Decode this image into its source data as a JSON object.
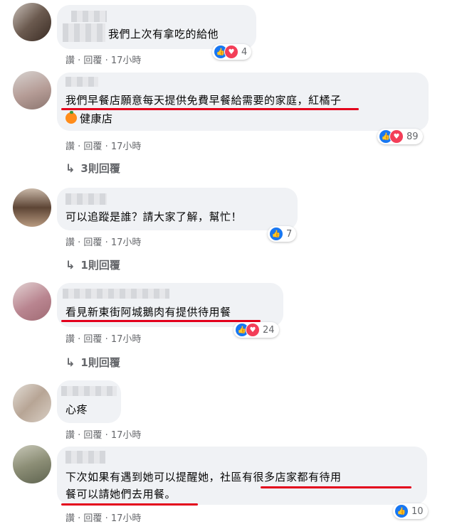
{
  "comments": [
    {
      "text_lines": [
        "我們上次有拿吃的給他"
      ],
      "meta": {
        "like": "讚",
        "reply": "回覆",
        "time": "17小時"
      },
      "reactions": {
        "count": "4",
        "types": [
          "like",
          "love"
        ]
      }
    },
    {
      "text_lines": [
        "我們早餐店願意每天提供免費早餐給需要的家庭，紅橘子",
        "健康店"
      ],
      "meta": {
        "like": "讚",
        "reply": "回覆",
        "time": "17小時"
      },
      "reactions": {
        "count": "89",
        "types": [
          "like",
          "love"
        ]
      },
      "replies_label": "3則回覆"
    },
    {
      "text_lines": [
        "可以追蹤是誰？請大家了解，幫忙！"
      ],
      "meta": {
        "like": "讚",
        "reply": "回覆",
        "time": "17小時"
      },
      "reactions": {
        "count": "7",
        "types": [
          "like"
        ]
      },
      "replies_label": "1則回覆"
    },
    {
      "text_lines": [
        "看見新東街阿城鵝肉有提供待用餐"
      ],
      "meta": {
        "like": "讚",
        "reply": "回覆",
        "time": "17小時"
      },
      "reactions": {
        "count": "24",
        "types": [
          "like",
          "love"
        ]
      },
      "replies_label": "1則回覆"
    },
    {
      "text_lines": [
        "心疼"
      ],
      "meta": {
        "like": "讚",
        "reply": "回覆",
        "time": "17小時"
      }
    },
    {
      "text_lines": [
        "下次如果有遇到她可以提醒她，社區有很多店家都有待用",
        "餐可以請她們去用餐。"
      ],
      "meta": {
        "like": "讚",
        "reply": "回覆",
        "time": "17小時"
      },
      "reactions": {
        "count": "10",
        "types": [
          "like"
        ]
      }
    }
  ],
  "colors": {
    "like": "#1877f2",
    "love": "#f33e58",
    "underline": "#e3001b",
    "bubble": "#f0f2f5"
  },
  "meta_separator": " · "
}
